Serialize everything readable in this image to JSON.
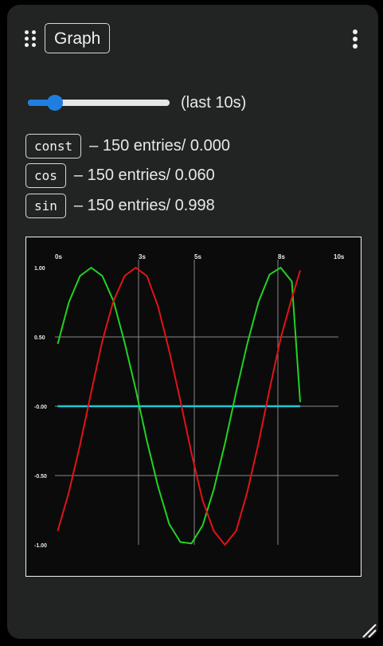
{
  "header": {
    "title": "Graph",
    "drag_icon": "drag-handle-icon",
    "menu_icon": "more-vertical-icon"
  },
  "slider": {
    "value_fraction": 0.19,
    "color": "#1f7ee0"
  },
  "window_label": "(last 10s)",
  "series": [
    {
      "name": "const",
      "info": "– 150 entries/ 0.000",
      "color": "#22c7d6"
    },
    {
      "name": "cos",
      "info": "– 150 entries/ 0.060",
      "color": "#21d321"
    },
    {
      "name": "sin",
      "info": "– 150 entries/ 0.998",
      "color": "#e3121a"
    }
  ],
  "chart_data": {
    "type": "line",
    "x_ticks": [
      "0s",
      "3s",
      "5s",
      "8s",
      "10s"
    ],
    "y_ticks": [
      "1.00",
      "0.50",
      "-0.00",
      "-0.50",
      "-1.00"
    ],
    "xlim": [
      0,
      10
    ],
    "ylim": [
      -1,
      1
    ],
    "grid": true,
    "series": [
      {
        "name": "const",
        "color": "#22c7d6",
        "x": [
          0.1,
          8.8
        ],
        "y": [
          0,
          0
        ]
      },
      {
        "name": "cos",
        "color": "#21d321",
        "x": [
          0.1,
          0.5,
          0.9,
          1.3,
          1.7,
          2.1,
          2.5,
          2.9,
          3.3,
          3.7,
          4.1,
          4.5,
          4.9,
          5.3,
          5.7,
          6.1,
          6.5,
          6.9,
          7.3,
          7.7,
          8.1,
          8.5,
          8.8
        ],
        "y": [
          0.45,
          0.75,
          0.94,
          1.0,
          0.94,
          0.76,
          0.46,
          0.12,
          -0.25,
          -0.58,
          -0.85,
          -0.98,
          -0.99,
          -0.86,
          -0.6,
          -0.27,
          0.1,
          0.45,
          0.75,
          0.95,
          1.0,
          0.9,
          0.03
        ]
      },
      {
        "name": "sin",
        "color": "#e3121a",
        "x": [
          0.1,
          0.5,
          0.9,
          1.3,
          1.7,
          2.1,
          2.5,
          2.9,
          3.3,
          3.7,
          4.1,
          4.5,
          4.9,
          5.3,
          5.7,
          6.1,
          6.5,
          6.9,
          7.3,
          7.7,
          8.1,
          8.5,
          8.8
        ],
        "y": [
          -0.9,
          -0.62,
          -0.28,
          0.1,
          0.47,
          0.76,
          0.94,
          1.0,
          0.94,
          0.72,
          0.4,
          0.04,
          -0.34,
          -0.68,
          -0.9,
          -1.0,
          -0.9,
          -0.62,
          -0.27,
          0.12,
          0.49,
          0.78,
          0.98
        ]
      }
    ]
  },
  "footer": {
    "resize_icon": "resize-handle-icon"
  }
}
